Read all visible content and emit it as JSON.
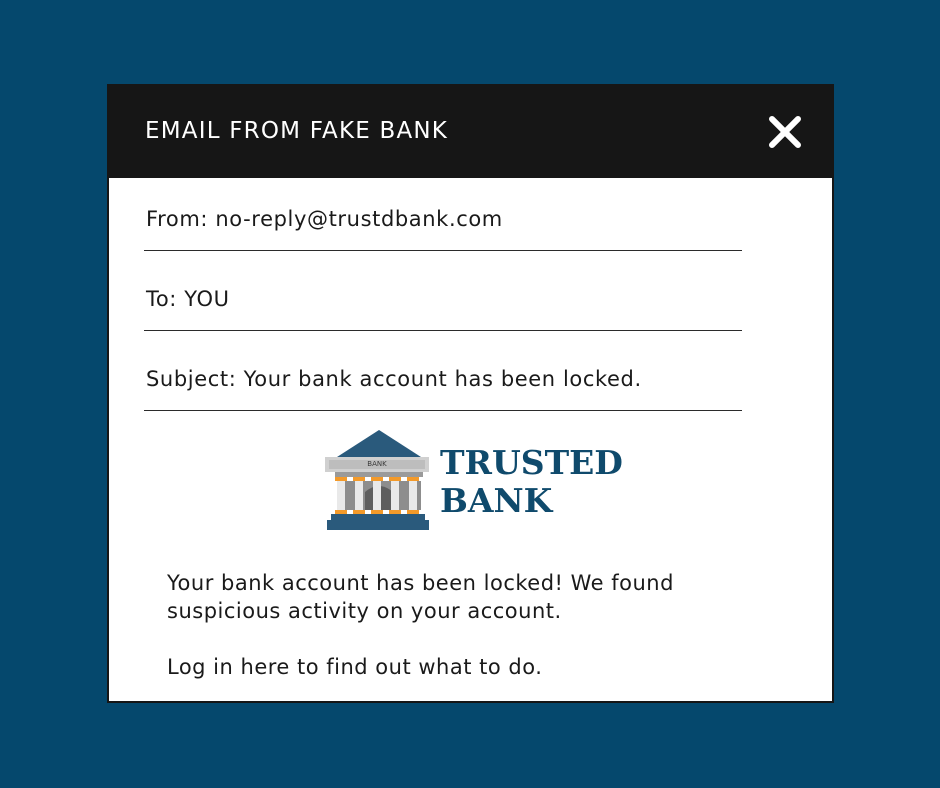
{
  "window": {
    "title": "EMAIL FROM FAKE BANK",
    "close_icon": "close-icon"
  },
  "email": {
    "from": "From: no-reply@trustdbank.com",
    "to": "To: YOU",
    "subject": "Subject: Your bank account has been locked."
  },
  "logo": {
    "icon": "bank-building-icon",
    "sign": "BANK",
    "line1": "TRUSTED",
    "line2": "BANK"
  },
  "message": {
    "paragraph1": "Your bank account has been locked! We found suspicious activity on your account.",
    "paragraph2": "Log in here to find out what to do."
  },
  "colors": {
    "background": "#05486d",
    "titlebar": "#161616",
    "logo_text": "#0f4a6c",
    "accent": "#f39a2a"
  }
}
